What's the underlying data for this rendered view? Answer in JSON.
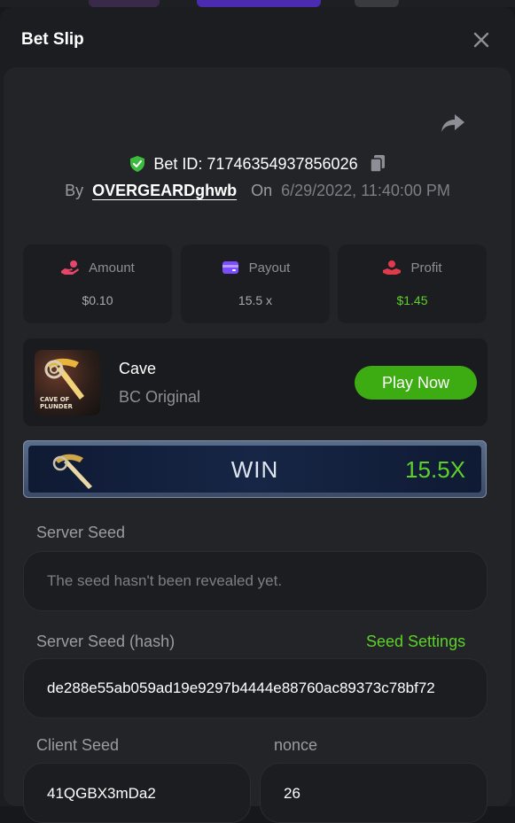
{
  "colors": {
    "accent": "#3dab12",
    "profit_green": "#5dd12a",
    "amount_icon": "#e5466a",
    "payout_icon": "#7b4dff",
    "profit_icon": "#e03b4c",
    "verified_shield": "#3dbb3f"
  },
  "modal": {
    "title": "Bet Slip"
  },
  "bet": {
    "id_label": "Bet ID: 71746354937856026",
    "by_label": "By",
    "username": "OVERGEARDghwb",
    "on_label": "On",
    "date": "6/29/2022, 11:40:00 PM"
  },
  "stats": {
    "amount": {
      "label": "Amount",
      "value": "$0.10",
      "icon": "hand-money-icon"
    },
    "payout": {
      "label": "Payout",
      "value": "15.5 x",
      "icon": "wallet-icon"
    },
    "profit": {
      "label": "Profit",
      "value": "$1.45",
      "icon": "profit-hand-icon"
    }
  },
  "game": {
    "name": "Cave",
    "provider": "BC Original",
    "thumb_text_1": "CAVE OF",
    "thumb_text_2": "PLUNDER",
    "play_label": "Play Now"
  },
  "result": {
    "label": "WIN",
    "multiplier": "15.5X"
  },
  "seeds": {
    "server_seed_label": "Server Seed",
    "server_seed_value": "The seed hasn't been revealed yet.",
    "server_hash_label": "Server Seed (hash)",
    "seed_settings_label": "Seed Settings",
    "server_hash_value": "de288e55ab059ad19e9297b4444e88760ac89373c78bf72",
    "client_seed_label": "Client Seed",
    "client_seed_value": "41QGBX3mDa2",
    "nonce_label": "nonce",
    "nonce_value": "26"
  }
}
